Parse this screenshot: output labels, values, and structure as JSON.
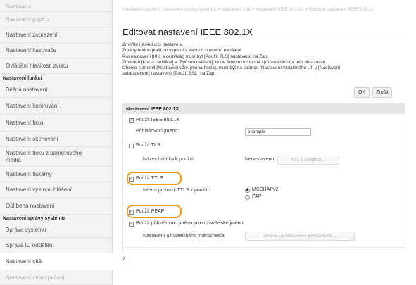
{
  "sidebar": {
    "items_top": [
      {
        "label": "Nastavení",
        "style": "faded"
      },
      {
        "label": "Nastavení papíru",
        "style": "faded"
      },
      {
        "label": "Nastavení zobrazení",
        "style": "normal"
      },
      {
        "label": "Nastavení časovače",
        "style": "normal"
      },
      {
        "label": "Ovládání hlasitosti zvuku",
        "style": "normal"
      }
    ],
    "section_functions": "Nastavení funkcí",
    "items_functions": [
      {
        "label": "Běžná nastavení"
      },
      {
        "label": "Nastavení kopírování"
      },
      {
        "label": "Nastavení faxu"
      },
      {
        "label": "Nastavení skenování"
      },
      {
        "label": "Nastavení tisku z paměťového média"
      },
      {
        "label": "Nastavení tiskárny"
      },
      {
        "label": "Nastavení výstupu hlášení"
      },
      {
        "label": "Oblíbená nastavení"
      }
    ],
    "section_system": "Nastavení správy systému",
    "items_system": [
      {
        "label": "Správa systému"
      },
      {
        "label": "Správa ID oddělení"
      },
      {
        "label": "Nastavení sítě"
      },
      {
        "label": "Nastavení zabezpečení"
      }
    ]
  },
  "main": {
    "breadcrumb": "Nastavení/Uložení: Nastavení správy systému > Nastavení sítě > Nastavení IEEE 802.1X > Editovat nastavení IEEE 802.1X",
    "title": "Editovat nastavení IEEE 802.1X",
    "notes": [
      "Změňte následující nastavení.",
      "Změny budou platit po vypnutí a zapnutí hlavního napájení.",
      "Pro nastavení [Klíč a certifikát] musí být [Použít TLS] nastaveno na Zap.",
      "Změnit-li [Klíč a certifikát] v [Způsob ověření], bude funkce dostupná i při změnění na této obrazovce.",
      "Chcete-li změnit [Nastavení uživ. jména/hesla], musí být na stránce [Nastavení vzdáleného UI] v [Nastavení",
      "zabezpečení] nastaveno [Použít SSL] na Zap."
    ],
    "ok_label": "OK",
    "cancel_label": "Zrušit",
    "panel": {
      "header": "Nastavení IEEE 802.1X",
      "use_ieee_label": "Použít IEEE 802.1X",
      "login_name_label": "Přihlašovací jméno:",
      "login_name_value": "example",
      "use_tls_label": "Použít TLS",
      "key_name_label": "Název tlačítka k použití:",
      "key_name_value": "Nenastaveno.",
      "key_cert_button": "Klíč a certifikát...",
      "use_ttls_label": "Použít TTLS",
      "ttls_protocol_label": "Interní protokol TTLS k použití:",
      "ttls_options": [
        "MSCHAPv2",
        "PAP"
      ],
      "ttls_selected": "MSCHAPv2",
      "use_peap_label": "Použít PEAP",
      "use_login_as_user_label": "Použít přihlašovací jméno jako uživatelské jméno",
      "user_pw_settings_label": "Nastavení uživatelského jména/hesla:",
      "change_user_pw_button": "Změna uživatelského jména/hesla..."
    },
    "top_link": "⊼"
  }
}
